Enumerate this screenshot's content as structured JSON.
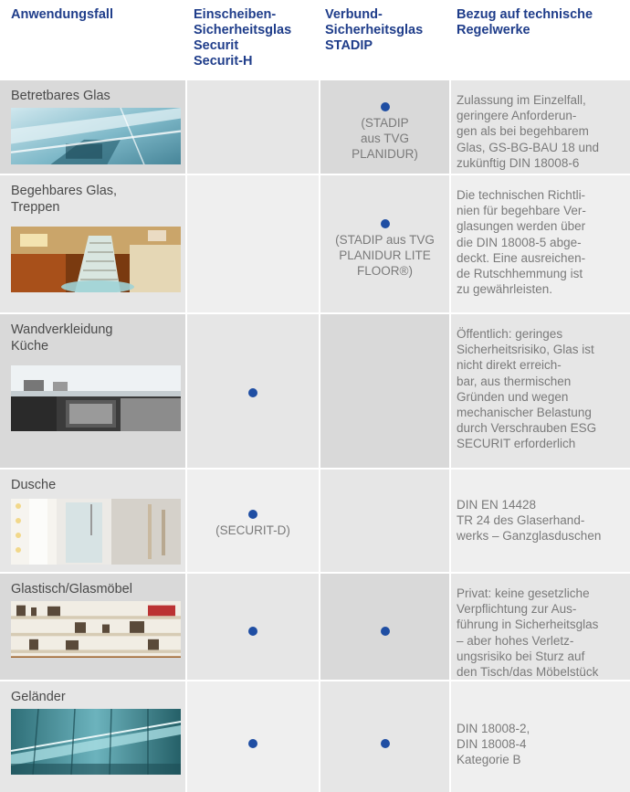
{
  "header": {
    "col1": "Anwendungsfall",
    "col2": "Einscheiben-\nSicherheitsglas\nSecurit\nSecurit-H",
    "col3": "Verbund-\nSicherheitsglas\nSTADIP",
    "col4": "Bezug auf technische\nRegelwerke"
  },
  "rows": [
    {
      "label": "Betretbares Glas",
      "esg_dot": false,
      "vsg_dot": true,
      "vsg_note": "(STADIP\naus TVG\nPLANIDUR)",
      "esg_note": "",
      "reference": "Zulassung im Einzelfall,\ngeringere Anforderun-\ngen als bei begehbarem\nGlas, GS-BG-BAU 18 und\nzukünftig DIN 18008-6"
    },
    {
      "label": "Begehbares Glas,\nTreppen",
      "esg_dot": false,
      "vsg_dot": true,
      "vsg_note": "(STADIP aus TVG\nPLANIDUR LITE\nFLOOR®)",
      "esg_note": "",
      "reference": "Die technischen Richtli-\nnien für begehbare Ver-\nglasungen werden über\ndie DIN 18008-5 abge-\ndeckt. Eine ausreichen-\nde Rutschhemmung ist\nzu gewährleisten."
    },
    {
      "label": "Wandverkleidung\nKüche",
      "esg_dot": true,
      "vsg_dot": false,
      "vsg_note": "",
      "esg_note": "",
      "reference": "Öffentlich: geringes\nSicherheitsrisiko, Glas ist\nnicht direkt erreich-\nbar, aus thermischen\nGründen und wegen\nmechanischer Belastung\ndurch Verschrauben ESG\nSECURIT erforderlich"
    },
    {
      "label": "Dusche",
      "esg_dot": true,
      "vsg_dot": false,
      "vsg_note": "",
      "esg_note": "(SECURIT-D)",
      "reference": "DIN EN 14428\nTR 24 des Glaserhand-\nwerks – Ganzglasduschen"
    },
    {
      "label": "Glastisch/Glasmöbel",
      "esg_dot": true,
      "vsg_dot": true,
      "vsg_note": "",
      "esg_note": "",
      "reference": "Privat: keine gesetzliche\nVerpflichtung zur Aus-\nführung in Sicherheitsglas\n– aber hohes Verletz-\nungsrisiko bei Sturz auf\nden Tisch/das Möbelstück"
    },
    {
      "label": "Geländer",
      "esg_dot": true,
      "vsg_dot": true,
      "vsg_note": "",
      "esg_note": "",
      "reference": "DIN 18008-2,\nDIN 18008-4\nKategorie B"
    }
  ],
  "colors": {
    "header_text": "#1f3d8a",
    "dot": "#1f4ea3"
  },
  "icons": {
    "bullet": "filled-circle"
  }
}
